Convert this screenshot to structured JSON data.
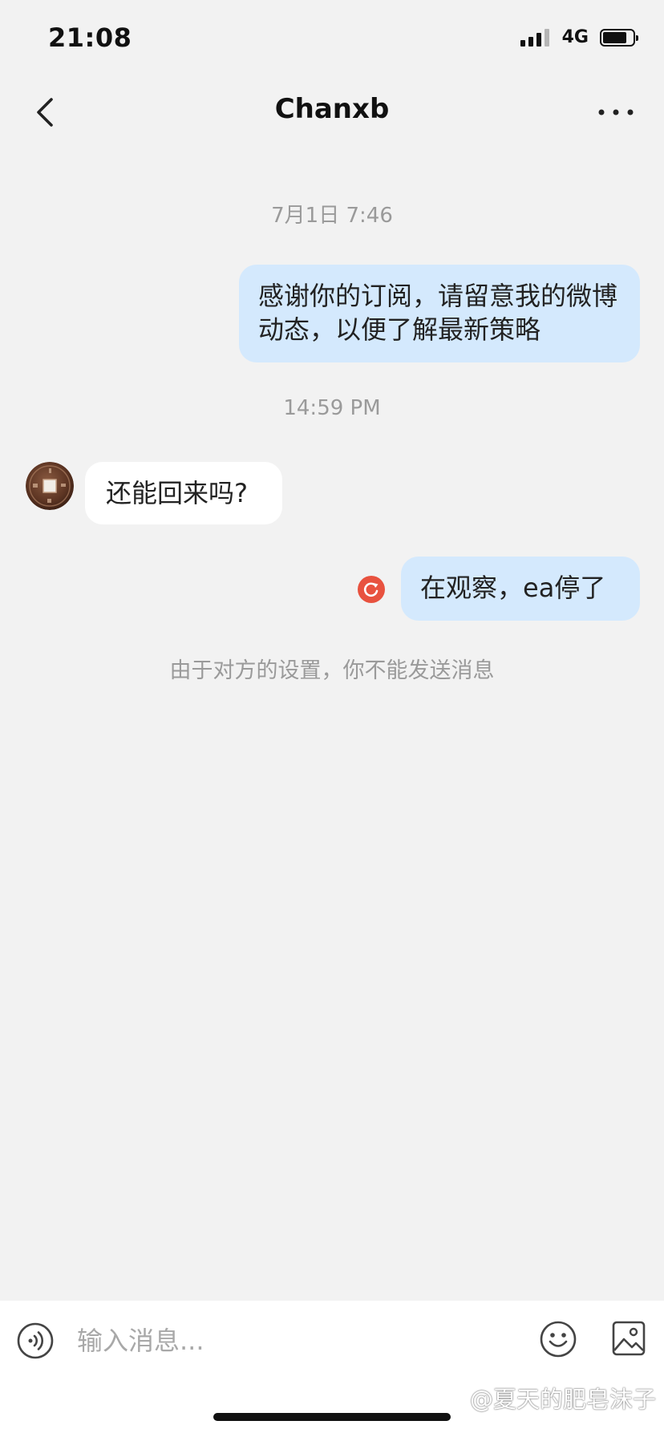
{
  "status_bar": {
    "time": "21:08",
    "network": "4G",
    "battery_level": 0.8
  },
  "nav": {
    "title": "Chanxb",
    "back_icon": "chevron-left-icon",
    "more_icon": "more-horizontal-icon"
  },
  "chat": {
    "timestamp_1": "7月1日 7:46",
    "message_1": "感谢你的订阅，请留意我的微博动态，以便了解最新策略",
    "timestamp_2": "14:59 PM",
    "message_2": "还能回来吗?",
    "message_3": "在观察，ea停了",
    "system_note": "由于对方的设置，你不能发送消息"
  },
  "input_bar": {
    "placeholder": "输入消息...",
    "voice_icon": "voice-icon",
    "emoji_icon": "emoji-icon",
    "image_icon": "image-icon"
  },
  "watermark": {
    "text": "@夏天的肥皂沫子"
  },
  "colors": {
    "background": "#f2f2f2",
    "outgoing_bubble": "#d4e9fd",
    "incoming_bubble": "#ffffff",
    "retry_red": "#e8523f",
    "muted_text": "#9a9a9a"
  }
}
